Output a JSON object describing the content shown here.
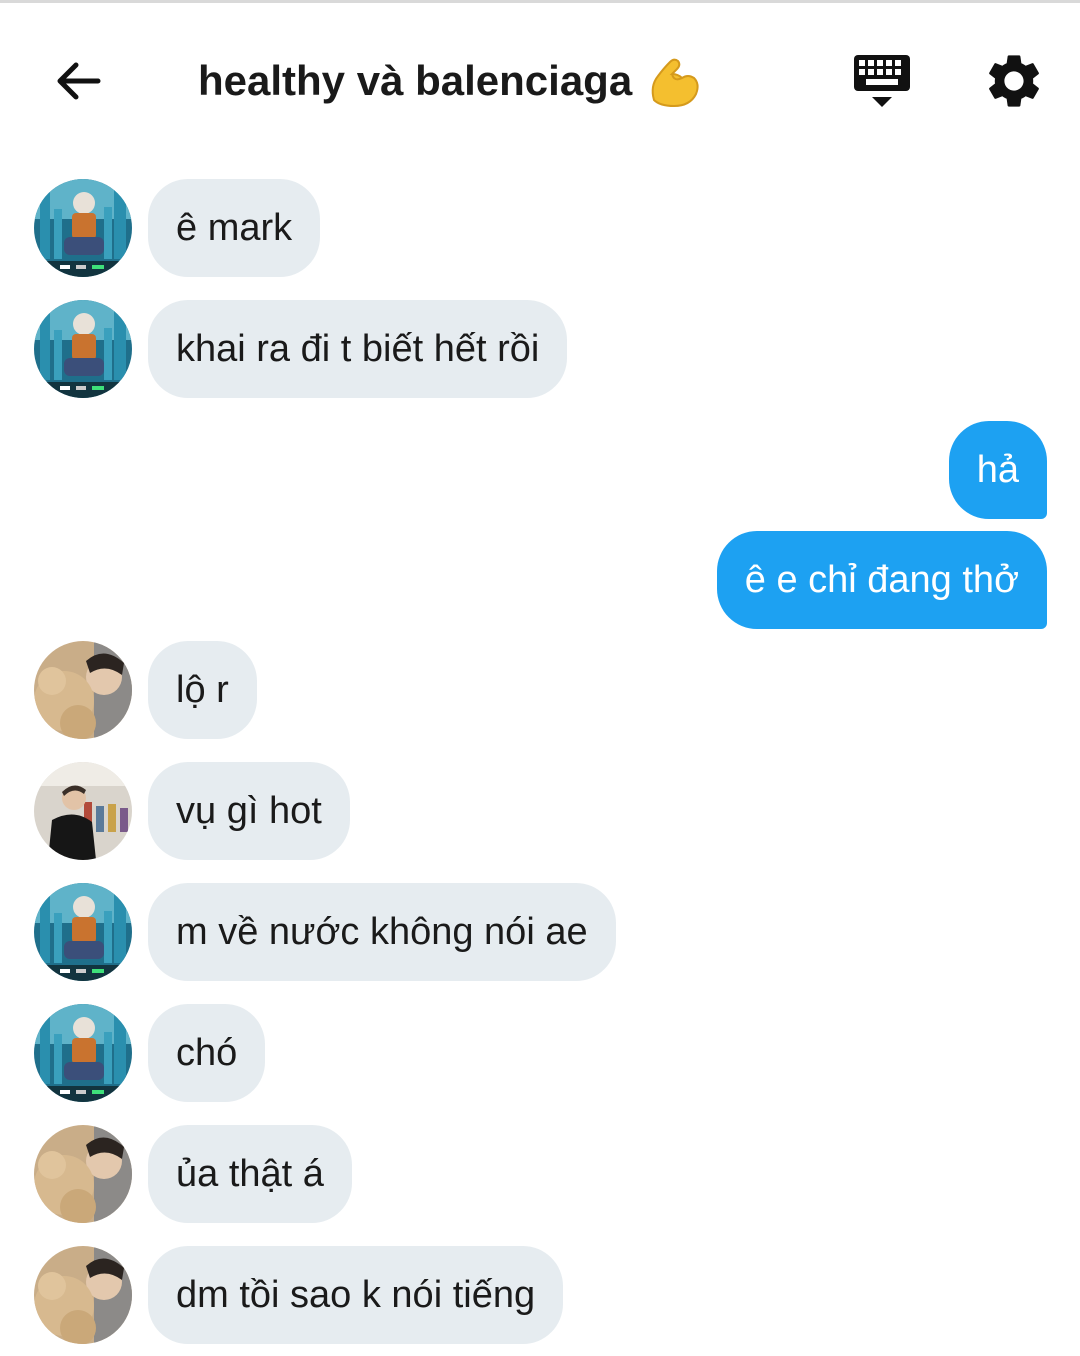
{
  "header": {
    "title": "healthy và balenciaga",
    "title_emoji": "flexed-biceps",
    "back_icon": "arrow-left-icon",
    "keyboard_icon": "keyboard-icon",
    "settings_icon": "gear-icon"
  },
  "colors": {
    "incoming_bubble": "#e6ecf0",
    "outgoing_bubble": "#1da1f2",
    "text": "#1a1a1a"
  },
  "messages": [
    {
      "direction": "in",
      "avatar": "avatar-a",
      "text": "ê mark"
    },
    {
      "direction": "in",
      "avatar": "avatar-a",
      "text": "khai ra đi t biết hết rồi"
    },
    {
      "direction": "out",
      "text": "hả"
    },
    {
      "direction": "out",
      "text": "ê e chỉ đang thở"
    },
    {
      "direction": "in",
      "avatar": "avatar-b",
      "text": "lộ r"
    },
    {
      "direction": "in",
      "avatar": "avatar-c",
      "text": "vụ gì hot"
    },
    {
      "direction": "in",
      "avatar": "avatar-a",
      "text": "m về nước không nói ae"
    },
    {
      "direction": "in",
      "avatar": "avatar-a",
      "text": "chó"
    },
    {
      "direction": "in",
      "avatar": "avatar-b",
      "text": "ủa thật á"
    },
    {
      "direction": "in",
      "avatar": "avatar-b",
      "text": "dm tồi sao k nói tiếng"
    }
  ]
}
